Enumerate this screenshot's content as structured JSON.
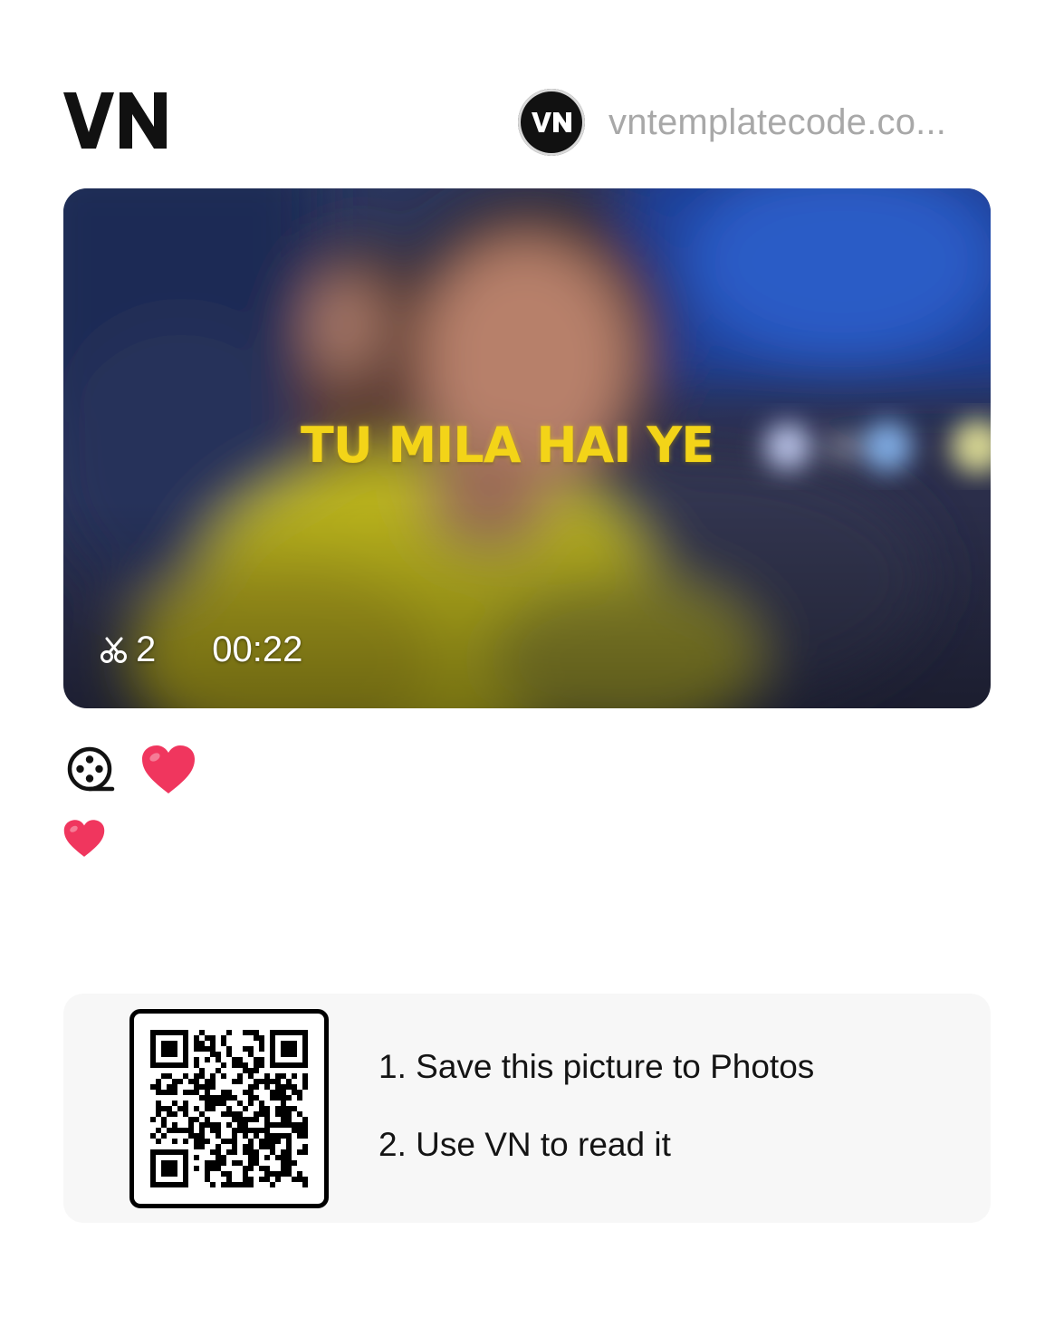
{
  "header": {
    "logo_text": "VN",
    "author": {
      "avatar_text": "VN",
      "name": "vntemplatecode.co..."
    }
  },
  "preview": {
    "lyric": "TU MILA HAI YE",
    "clip_count": "2",
    "duration": "00:22",
    "icons": {
      "clips": "scissors-icon"
    }
  },
  "tags": {
    "icons": [
      "film-reel-icon",
      "heart-icon"
    ],
    "description_icon": "heart-icon"
  },
  "qr": {
    "steps": [
      "1. Save this picture to Photos",
      "2. Use VN to read it"
    ]
  },
  "colors": {
    "lyric": "#f3d418",
    "heart": "#f0365e",
    "author_name": "#a8a8a8",
    "qr_panel": "#f7f7f7"
  }
}
